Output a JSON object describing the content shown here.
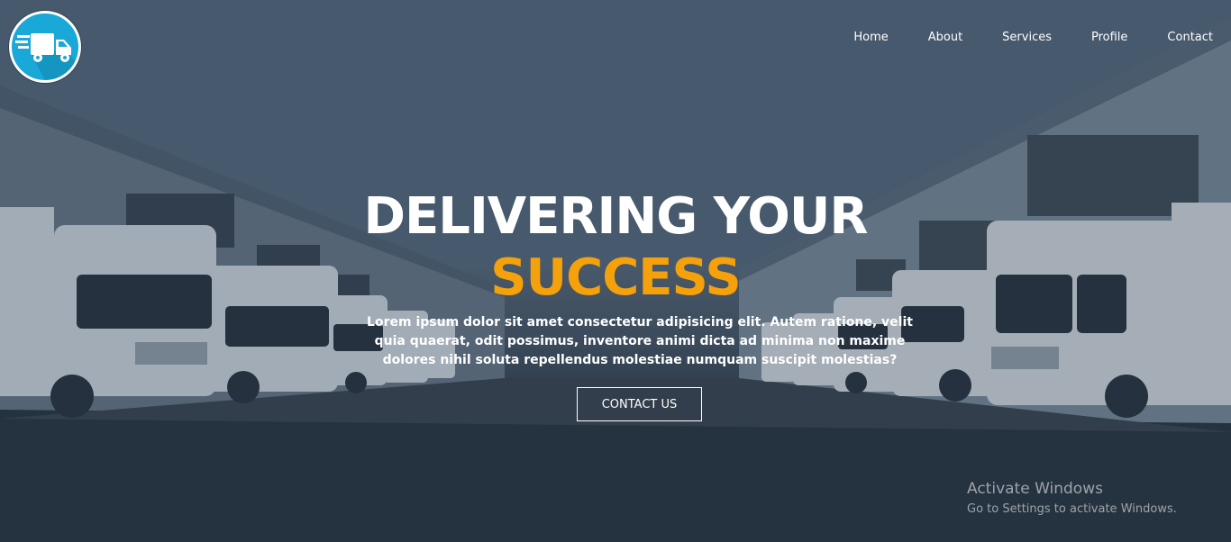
{
  "logo": {
    "icon": "delivery-truck-icon",
    "color": "#1aa8d8"
  },
  "nav": {
    "items": [
      {
        "label": "Home"
      },
      {
        "label": "About"
      },
      {
        "label": "Services"
      },
      {
        "label": "Profile"
      },
      {
        "label": "Contact"
      }
    ]
  },
  "hero": {
    "headline_line1": "DELIVERING YOUR",
    "headline_line2": "SUCCESS",
    "description": "Lorem ipsum dolor sit amet consectetur adipisicing elit. Autem ratione, velit quia quaerat, odit possimus, inventore animi dicta ad minima non maxime dolores nihil soluta repellendus molestiae numquam suscipit molestias?",
    "cta_label": "CONTACT US",
    "accent_color": "#f5a10b"
  },
  "watermark": {
    "title": "Activate Windows",
    "subtitle": "Go to Settings to activate Windows."
  }
}
